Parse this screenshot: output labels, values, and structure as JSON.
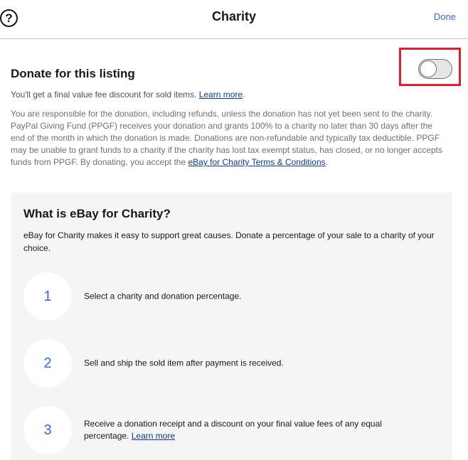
{
  "header": {
    "help_symbol": "?",
    "title": "Charity",
    "done_label": "Done"
  },
  "donate": {
    "title": "Donate for this listing",
    "toggle_on": false,
    "fee_text": "You'll get a final value fee discount for sold items.",
    "fee_link": "Learn more",
    "fee_period": ".",
    "legal_text": "You are responsible for the donation, including refunds, unless the donation has not yet been sent to the charity. PayPal Giving Fund (PPGF) receives your donation and grants 100% to a charity no later than 30 days after the end of the month in which the donation is made. Donations are non-refundable and typically tax deductible. PPGF may be unable to grant funds to a charity if the charity has lost tax exempt status, has closed, or no longer accepts funds from PPGF. By donating, you accept the ",
    "legal_link": "eBay for Charity Terms & Conditions",
    "legal_period": "."
  },
  "info": {
    "title": "What is eBay for Charity?",
    "description": "eBay for Charity makes it easy to support great causes. Donate a percentage of your sale to a charity of your choice.",
    "steps": [
      {
        "number": "1",
        "text": "Select a charity and donation percentage."
      },
      {
        "number": "2",
        "text": "Sell and ship the sold item after payment is received."
      },
      {
        "number": "3",
        "text": "Receive a donation receipt and a discount on your final value fees of any equal percentage. ",
        "link": "Learn more"
      }
    ]
  },
  "colors": {
    "accent": "#3665f3",
    "link": "#0b3aa8",
    "highlight": "#e0202e",
    "info_bg": "#f5f5f5"
  }
}
